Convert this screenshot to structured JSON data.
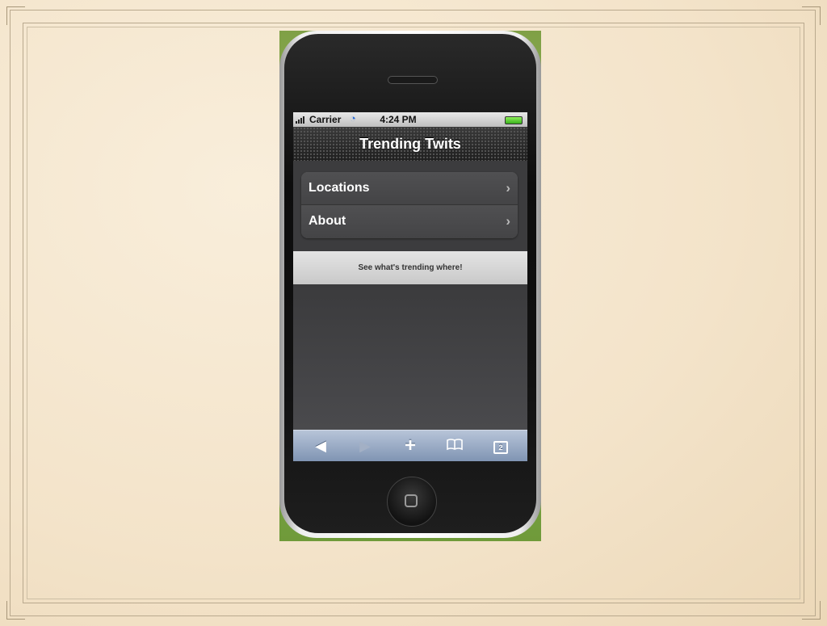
{
  "status_bar": {
    "carrier": "Carrier",
    "time": "4:24 PM",
    "wifi_icon": "wifi-icon",
    "battery_icon": "battery-icon",
    "signal_icon": "signal-bars-icon"
  },
  "nav": {
    "title": "Trending Twits"
  },
  "menu": {
    "items": [
      {
        "label": "Locations",
        "icon": "chevron-right-icon"
      },
      {
        "label": "About",
        "icon": "chevron-right-icon"
      }
    ]
  },
  "banner": {
    "text": "See what's trending where!"
  },
  "toolbar": {
    "back_icon": "back-arrow-icon",
    "forward_icon": "forward-arrow-icon",
    "add_icon": "plus-icon",
    "bookmarks_icon": "bookmarks-icon",
    "pages_icon": "pages-icon",
    "pages_count": "2"
  },
  "colors": {
    "slide_background": "#f4e6cf",
    "navbar": "#2b2b2b",
    "toolbar": "#8d9fbb",
    "banner": "#d6d6d6"
  }
}
